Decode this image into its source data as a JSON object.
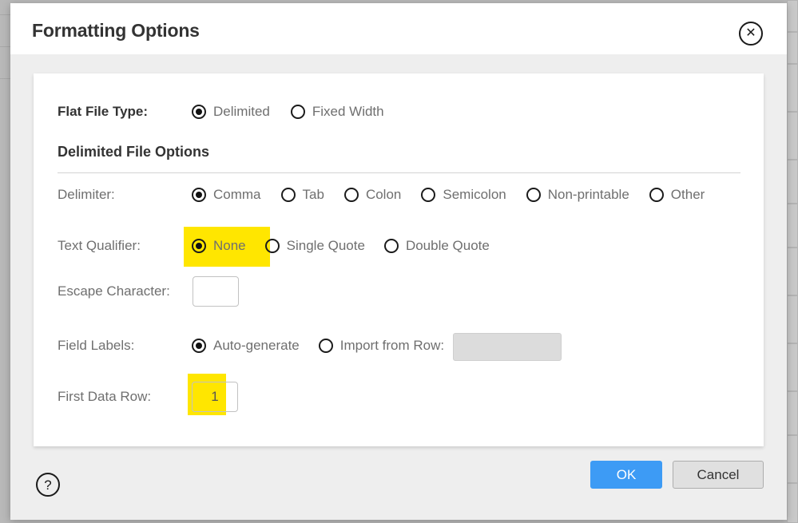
{
  "dialog": {
    "title": "Formatting Options",
    "close_icon": "close-circle-icon",
    "help_icon": "question-circle-icon",
    "close_glyph": "✕",
    "help_glyph": "?"
  },
  "colors": {
    "accent": "#3d9bf5",
    "highlight": "#ffe600",
    "card_background": "#ffffff",
    "dialog_background": "#eeeeee",
    "label_text": "#6f6f6f",
    "heading_text": "#333333"
  },
  "form": {
    "flat_file_type": {
      "label": "Flat File Type:",
      "selected": "Delimited",
      "options": [
        {
          "label": "Delimited",
          "checked": true
        },
        {
          "label": "Fixed Width",
          "checked": false
        }
      ]
    },
    "section_heading": "Delimited File Options",
    "delimiter": {
      "label": "Delimiter:",
      "selected": "Comma",
      "options": [
        {
          "label": "Comma",
          "checked": true
        },
        {
          "label": "Tab",
          "checked": false
        },
        {
          "label": "Colon",
          "checked": false
        },
        {
          "label": "Semicolon",
          "checked": false
        },
        {
          "label": "Non-printable",
          "checked": false
        },
        {
          "label": "Other",
          "checked": false
        }
      ]
    },
    "text_qualifier": {
      "label": "Text Qualifier:",
      "selected": "None",
      "highlighted": true,
      "options": [
        {
          "label": "None",
          "checked": true
        },
        {
          "label": "Single Quote",
          "checked": false
        },
        {
          "label": "Double Quote",
          "checked": false
        }
      ]
    },
    "escape_character": {
      "label": "Escape Character:",
      "value": "",
      "placeholder": ""
    },
    "field_labels": {
      "label": "Field Labels:",
      "selected": "Auto-generate",
      "options": [
        {
          "label": "Auto-generate",
          "checked": true
        },
        {
          "label": "Import from Row:",
          "checked": false
        }
      ],
      "import_from_row": {
        "value": "",
        "placeholder": "",
        "disabled": true
      }
    },
    "first_data_row": {
      "label": "First Data Row:",
      "value": "1",
      "highlighted": true
    }
  },
  "footer": {
    "ok_label": "OK",
    "cancel_label": "Cancel"
  }
}
